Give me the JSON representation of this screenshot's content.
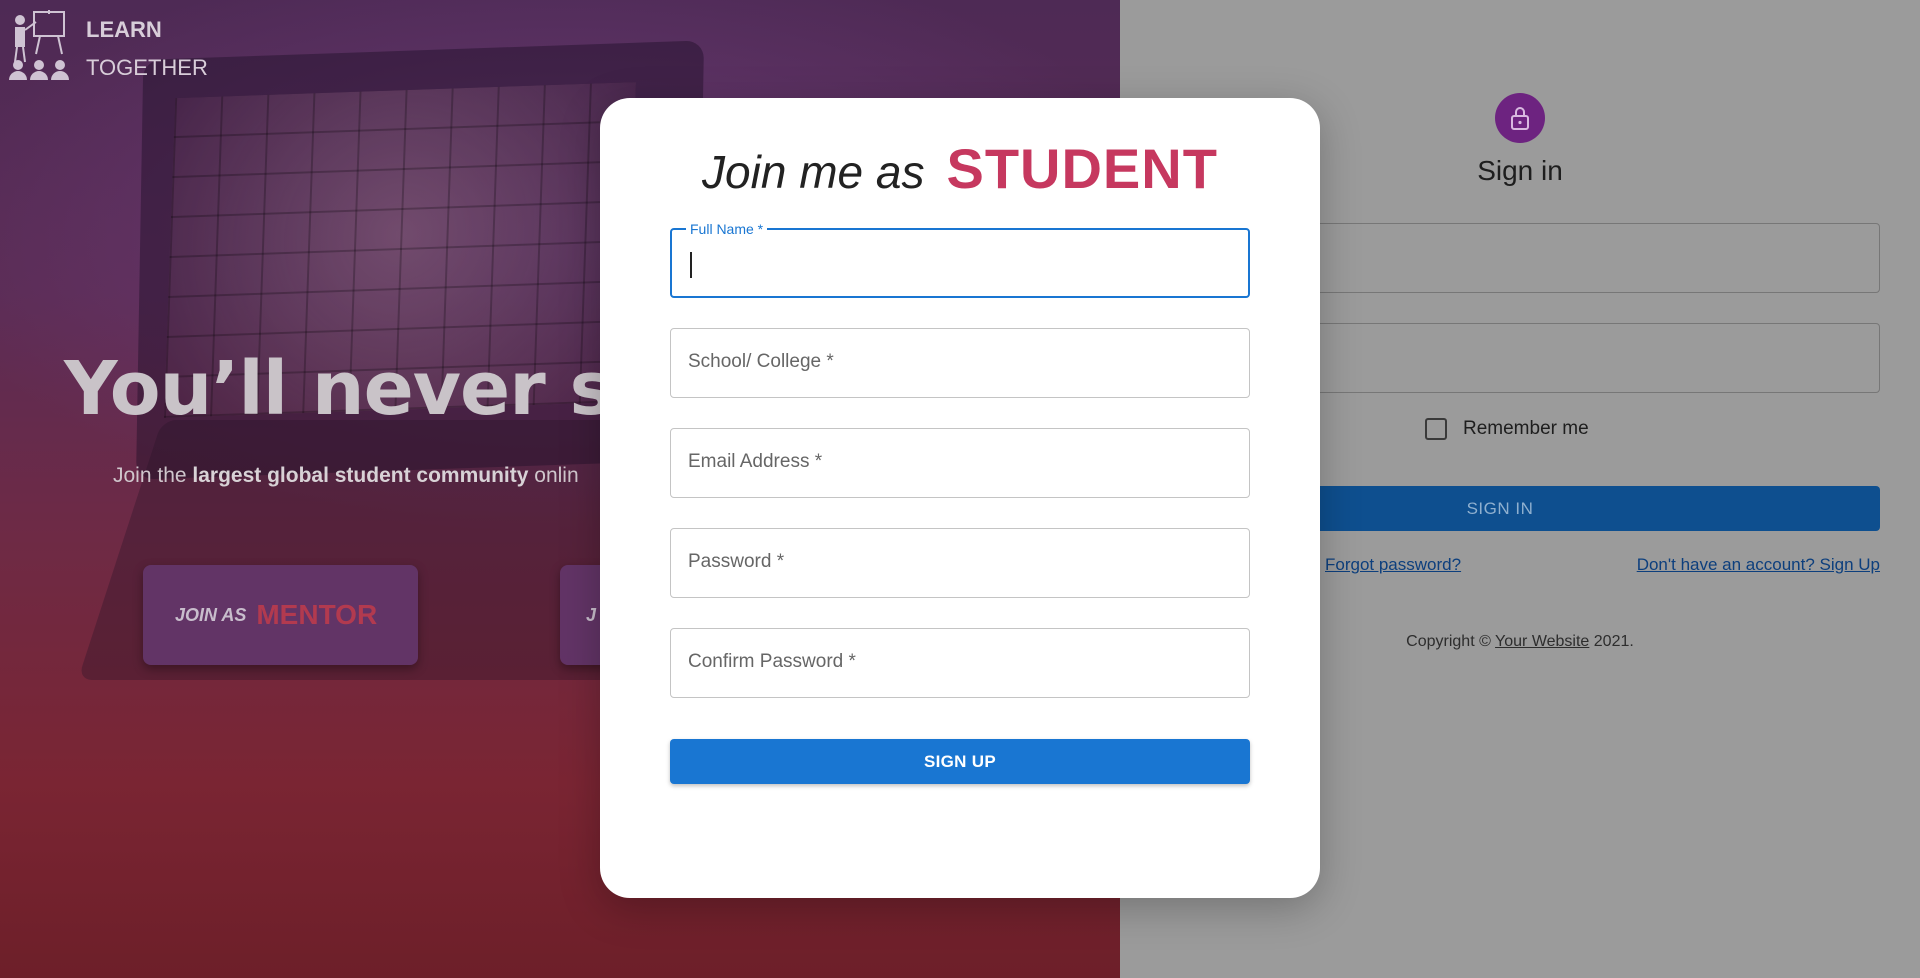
{
  "brand": {
    "line1": "LEARN",
    "line2": "TOGETHER"
  },
  "hero": {
    "headline": "You’ll never stud",
    "subtitle_prefix": "Join the ",
    "subtitle_bold": "largest global student community",
    "subtitle_suffix": " onlin",
    "join_mentor": {
      "prefix": "JOIN AS",
      "role": "MENTOR"
    },
    "join_other": {
      "prefix": "J"
    }
  },
  "signin": {
    "title": "Sign in",
    "remember_label": "Remember me",
    "button_label": "SIGN IN",
    "forgot_link": "Forgot password?",
    "signup_link": "Don't have an account? Sign Up",
    "copyright_prefix": "Copyright © ",
    "copyright_link": "Your Website",
    "copyright_suffix": " 2021."
  },
  "modal": {
    "title_prefix": "Join me as",
    "title_role": "STUDENT",
    "fields": [
      {
        "label": "Full Name *",
        "value": ""
      },
      {
        "label": "School/ College *",
        "value": ""
      },
      {
        "label": "Email Address *",
        "value": ""
      },
      {
        "label": "Password *",
        "value": ""
      },
      {
        "label": "Confirm Password *",
        "value": ""
      }
    ],
    "submit_label": "SIGN UP"
  },
  "colors": {
    "accent_blue": "#1976d2",
    "student_role": "#c6385f",
    "lock_avatar": "#6d2380"
  },
  "icons": {
    "logo": "teacher-class-icon",
    "avatar": "lock-icon"
  }
}
